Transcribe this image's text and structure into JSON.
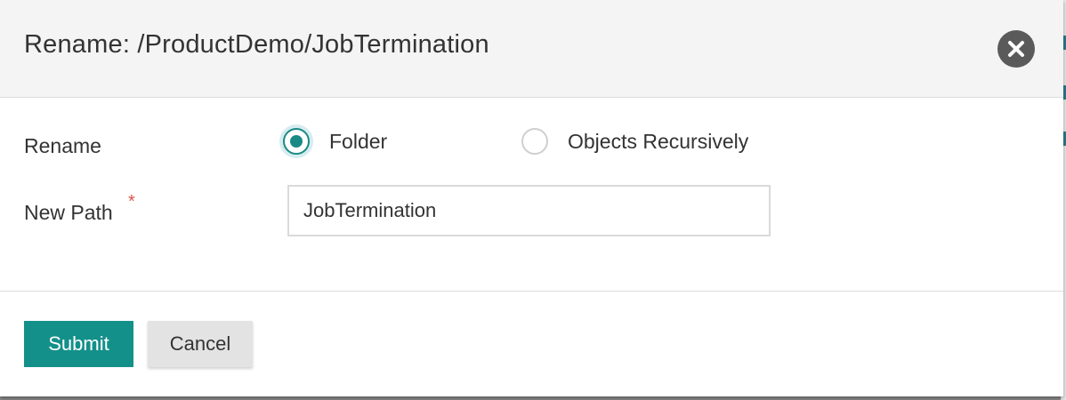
{
  "dialog": {
    "title": "Rename: /ProductDemo/JobTermination",
    "close_icon": "close-icon"
  },
  "form": {
    "rename_label": "Rename",
    "options": [
      {
        "label": "Folder",
        "checked": true
      },
      {
        "label": "Objects Recursively",
        "checked": false
      }
    ],
    "new_path_label": "New Path",
    "required_marker": "*",
    "new_path_value": "JobTermination"
  },
  "actions": {
    "submit_label": "Submit",
    "cancel_label": "Cancel"
  },
  "colors": {
    "accent": "#14908a",
    "required": "#d9534f",
    "close_bg": "#5a5a5a"
  }
}
